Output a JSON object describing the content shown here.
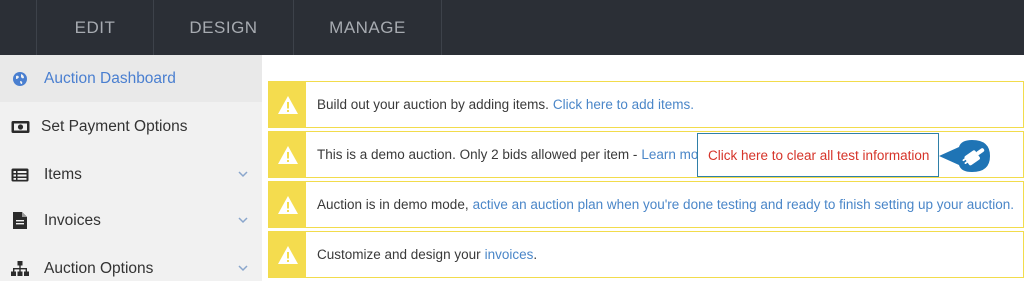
{
  "nav": {
    "tabs": [
      {
        "label": "EDIT"
      },
      {
        "label": "DESIGN"
      },
      {
        "label": "MANAGE"
      }
    ]
  },
  "sidebar": {
    "items": [
      {
        "label": "Auction Dashboard",
        "icon": "globe-icon",
        "active": true
      },
      {
        "label": "Set Payment Options",
        "icon": "money-icon"
      },
      {
        "label": "Items",
        "icon": "list-icon"
      },
      {
        "label": "Invoices",
        "icon": "document-icon"
      },
      {
        "label": "Auction Options",
        "icon": "sitemap-icon"
      }
    ]
  },
  "alerts": [
    {
      "text": "Build out your auction by adding items.",
      "link": "Click here to add items.",
      "suffix": ""
    },
    {
      "text": "This is a demo auction. Only 2 bids allowed per item -",
      "link": "Learn more.",
      "suffix": ""
    },
    {
      "text": "Auction is in demo mode,",
      "link": "active an auction plan when you're done testing and ready to finish setting up your auction.",
      "suffix": ""
    },
    {
      "text": "Customize and design your",
      "link": "invoices",
      "suffix": "."
    }
  ],
  "clear_action": {
    "label": "Click here to clear all test information"
  },
  "colors": {
    "topbar": "#2b2f36",
    "active_link": "#4a7fd0",
    "warning": "#f4dc4e",
    "link": "#4a86c8",
    "danger": "#d6342a",
    "pointer": "#1f74b5"
  }
}
